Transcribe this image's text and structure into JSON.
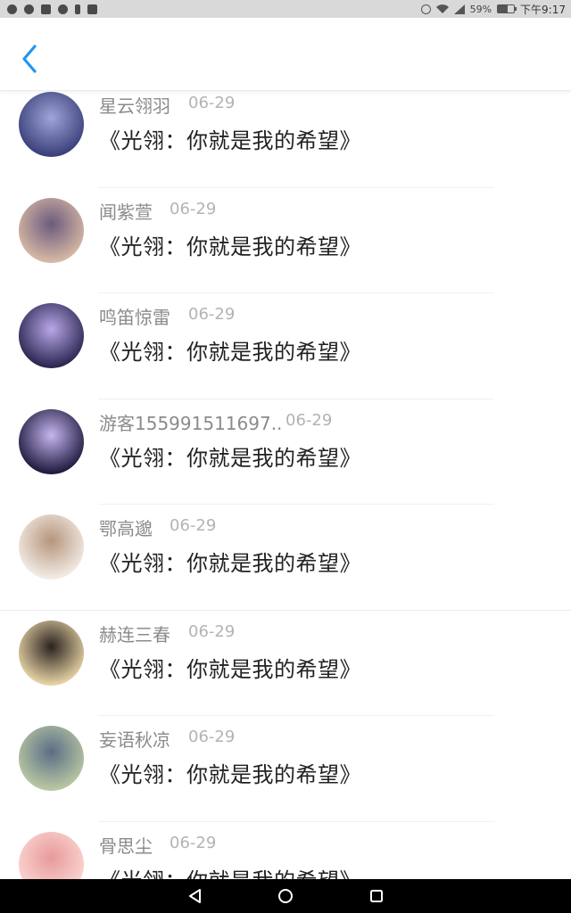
{
  "status_bar": {
    "battery": "59%",
    "time": "下午9:17",
    "battery_level": 0.59
  },
  "header": {
    "back_icon": "chevron-left-icon",
    "accent_color": "#2196f3"
  },
  "comments": [
    {
      "name": "星云翎羽",
      "date": "06-29",
      "message": "《光翎：你就是我的希望》",
      "avatar_colors": [
        "#3a3f7a",
        "#9fa6d8"
      ]
    },
    {
      "name": "闻紫萱",
      "date": "06-29",
      "message": "《光翎：你就是我的希望》",
      "avatar_colors": [
        "#d8b9a4",
        "#6a5a7e"
      ]
    },
    {
      "name": "鸣笛惊雷",
      "date": "06-29",
      "message": "《光翎：你就是我的希望》",
      "avatar_colors": [
        "#2a2650",
        "#b9a7e8"
      ]
    },
    {
      "name": "游客155991511697..",
      "date": "06-29",
      "message": "《光翎：你就是我的希望》",
      "avatar_colors": [
        "#1e1a3e",
        "#c6b5ef"
      ]
    },
    {
      "name": "鄂高邈",
      "date": "06-29",
      "message": "《光翎：你就是我的希望》",
      "avatar_colors": [
        "#f3ece6",
        "#b5957c"
      ]
    },
    {
      "name": "赫连三春",
      "date": "06-29",
      "message": "《光翎：你就是我的希望》",
      "avatar_colors": [
        "#e7d3a5",
        "#2a2320"
      ]
    },
    {
      "name": "妄语秋凉",
      "date": "06-29",
      "message": "《光翎：你就是我的希望》",
      "avatar_colors": [
        "#b9c8a2",
        "#5b6d86"
      ]
    },
    {
      "name": "骨思尘",
      "date": "06-29",
      "message": "《光翎：你就是我的希望》",
      "avatar_colors": [
        "#fbd6d2",
        "#e79a9a"
      ]
    }
  ],
  "nav_bar": {
    "back": "triangle-back-icon",
    "home": "circle-home-icon",
    "recents": "square-recents-icon"
  }
}
